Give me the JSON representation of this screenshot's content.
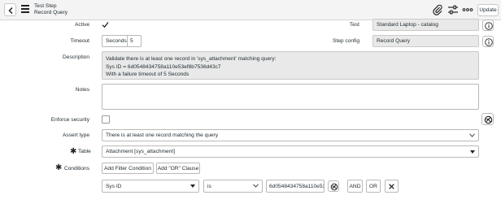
{
  "header": {
    "title": "Test Step",
    "subtitle": "Record Query",
    "update_label": "Update"
  },
  "icons": {
    "back": "chevron-left-icon",
    "menu": "hamburger-menu-icon",
    "attach": "paperclip-icon",
    "settings": "sliders-icon",
    "more": "ellipsis-icon",
    "info": "info-icon",
    "script": "script-toggle-icon",
    "required": "required-asterisk-icon",
    "remove": "close-icon"
  },
  "form": {
    "active": {
      "label": "Active",
      "checked": true
    },
    "timeout": {
      "label": "Timeout",
      "unit": "Seconds",
      "value": "5"
    },
    "test": {
      "label": "Test",
      "value": "Standard Laptop - catalog"
    },
    "step_config": {
      "label": "Step config",
      "value": "Record Query"
    },
    "description": {
      "label": "Description",
      "lines": [
        "Validate there is at least one record in 'sys_attachment' matching query:",
        "Sys ID = 6d0548434758a110e53ef8b7536d43c7",
        "With a failure timeout of 5 Seconds"
      ]
    },
    "notes": {
      "label": "Notes",
      "value": ""
    },
    "enforce_security": {
      "label": "Enforce security",
      "checked": false
    },
    "assert_type": {
      "label": "Assert type",
      "value": "There is at least one record matching the query"
    },
    "table": {
      "label": "Table",
      "value": "Attachment [sys_attachment]"
    },
    "conditions": {
      "label": "Conditions",
      "add_filter_label": "Add Filter Condition",
      "add_or_label": "Add \"OR\" Clause",
      "field": "Sys ID",
      "operator": "is",
      "value": "6d0548434758a110e53ef8b7536d43c7",
      "and_label": "AND",
      "or_label": "OR"
    }
  },
  "colors": {
    "header_bg": "#f4f4f4",
    "readonly_bg": "#e9e9e9",
    "border": "#b9b9b9"
  }
}
